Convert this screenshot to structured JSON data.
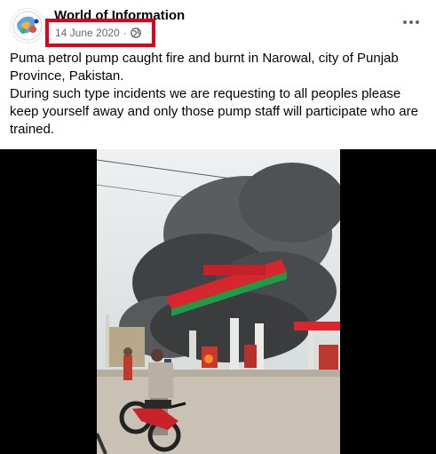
{
  "post": {
    "page_name": "World of Information",
    "date": "14 June 2020",
    "separator": "·",
    "audience_icon": "globe-icon",
    "more_icon": "more-horizontal-icon",
    "text_line1": "Puma petrol pump caught fire and burnt in Narowal, city of Punjab Province, Pakistan.",
    "text_line2": "During such type incidents we are requesting to all peoples please keep yourself away and only those pump staff will participate who are trained."
  },
  "annotation": {
    "highlight_color": "#e3001b"
  },
  "colors": {
    "text": "#050505",
    "secondary": "#65676b",
    "canopy_red": "#d7262e",
    "canopy_green": "#1f9b45"
  }
}
